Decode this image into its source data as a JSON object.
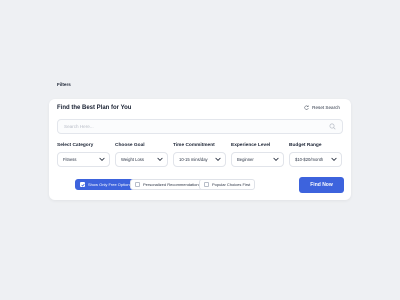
{
  "card": {
    "title": "Find the Best Plan for You",
    "reset_label": "Reset Search",
    "reset_icon": "refresh-icon"
  },
  "search": {
    "placeholder": "Search Here...",
    "value": "",
    "icon": "search-icon"
  },
  "fields": [
    {
      "label": "Select Category",
      "value": "Fitness"
    },
    {
      "label": "Choose Goal",
      "value": "Weight Loss"
    },
    {
      "label": "Time Commitment",
      "value": "10-15 mins/day"
    },
    {
      "label": "Experience Level",
      "value": "Beginner"
    },
    {
      "label": "Budget Range",
      "value": "$10-$20/month"
    }
  ],
  "filters": {
    "label": "Filters",
    "options": [
      {
        "label": "Show Only Free Options",
        "checked": true
      },
      {
        "label": "Personalized Recommendations",
        "checked": false
      },
      {
        "label": "Popular Choices First",
        "checked": false
      }
    ]
  },
  "action": {
    "find_label": "Find Now"
  },
  "colors": {
    "accent": "#3d63dd",
    "background": "#eef0f3",
    "card": "#ffffff",
    "text": "#1a2233"
  }
}
